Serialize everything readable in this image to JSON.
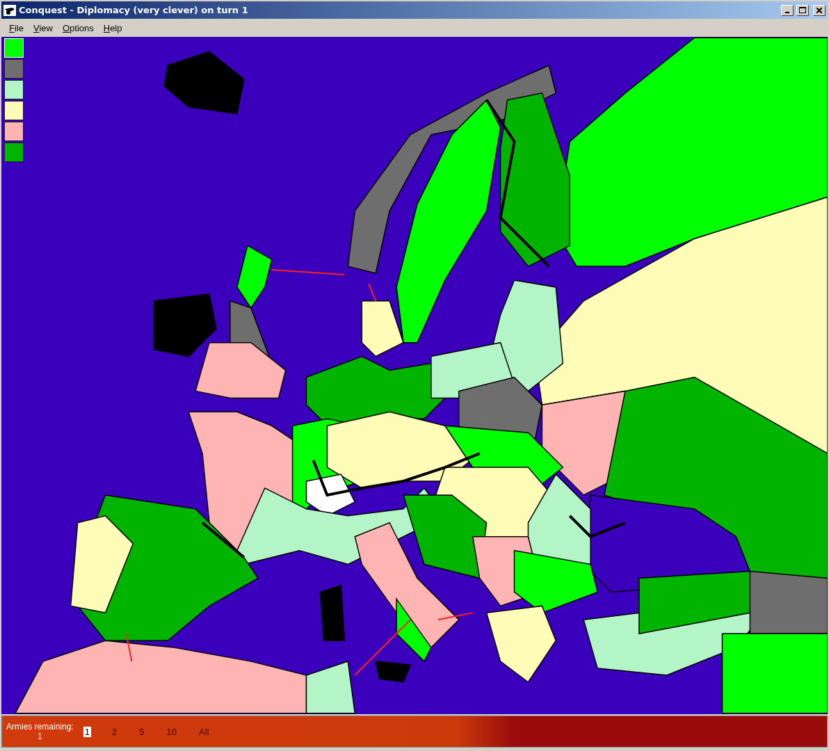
{
  "window": {
    "title": "Conquest - Diplomacy (very clever) on turn 1"
  },
  "menu": [
    {
      "label": "File"
    },
    {
      "label": "View"
    },
    {
      "label": "Options"
    },
    {
      "label": "Help"
    }
  ],
  "players": [
    {
      "color": "#00ff00",
      "selected": true
    },
    {
      "color": "#6e6e6e",
      "selected": false
    },
    {
      "color": "#b4f5c8",
      "selected": false
    },
    {
      "color": "#fffcb8",
      "selected": false
    },
    {
      "color": "#ffb4b4",
      "selected": false
    },
    {
      "color": "#00b400",
      "selected": false
    }
  ],
  "status_bar": {
    "label": "Armies remaining:",
    "value": "1",
    "options": [
      {
        "label": "1",
        "selected": true
      },
      {
        "label": "2",
        "selected": false
      },
      {
        "label": "5",
        "selected": false
      },
      {
        "label": "10",
        "selected": false
      },
      {
        "label": "All",
        "selected": false
      }
    ]
  }
}
